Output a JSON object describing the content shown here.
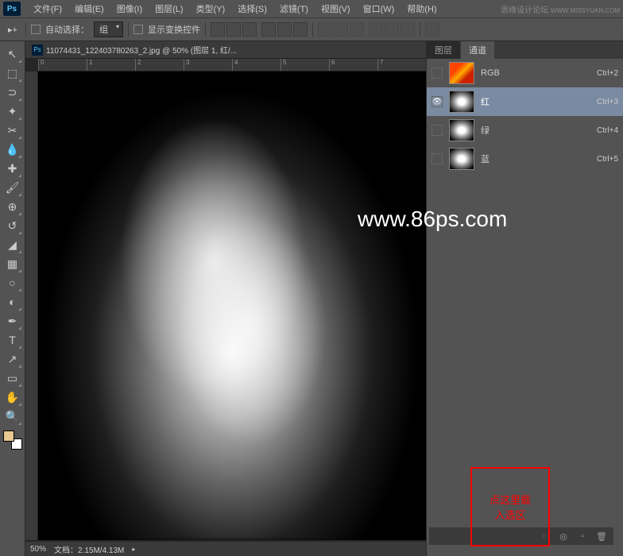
{
  "app": {
    "logo": "Ps"
  },
  "menu": [
    "文件(F)",
    "编辑(E)",
    "图像(I)",
    "图层(L)",
    "类型(Y)",
    "选择(S)",
    "滤镜(T)",
    "视图(V)",
    "窗口(W)",
    "帮助(H)"
  ],
  "brand": {
    "text": "思缘设计论坛",
    "url": "WWW.MISSYUAN.COM"
  },
  "options": {
    "auto_select": "自动选择：",
    "group": "组",
    "show_transform": "显示变换控件"
  },
  "document": {
    "tab_title": "11074431_122403780263_2.jpg @ 50% (图层 1, 红/...",
    "ruler_marks": [
      "0",
      "1",
      "2",
      "3",
      "4",
      "5",
      "6",
      "7"
    ],
    "zoom": "50%",
    "doc_info": "文档：2.15M/4.13M"
  },
  "panels": {
    "tabs": {
      "layers": "图层",
      "channels": "通道"
    },
    "channels": [
      {
        "name": "RGB",
        "key": "Ctrl+2",
        "thumb": "rgb",
        "visible": false,
        "selected": false
      },
      {
        "name": "红",
        "key": "Ctrl+3",
        "thumb": "gray",
        "visible": true,
        "selected": true
      },
      {
        "name": "绿",
        "key": "Ctrl+4",
        "thumb": "gray",
        "visible": false,
        "selected": false
      },
      {
        "name": "蓝",
        "key": "Ctrl+5",
        "thumb": "gray",
        "visible": false,
        "selected": false
      }
    ]
  },
  "watermark": "www.86ps.com",
  "annotation": {
    "line1": "点这里载",
    "line2": "入选区"
  }
}
